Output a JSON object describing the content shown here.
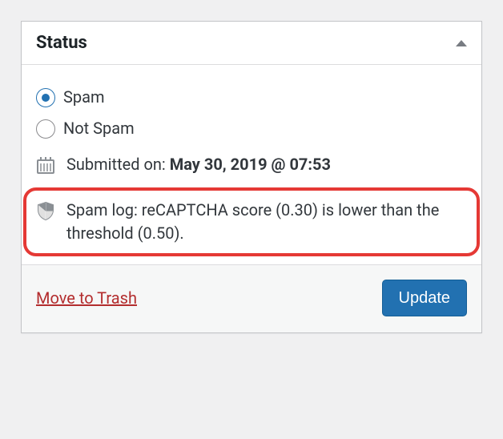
{
  "panel": {
    "title": "Status"
  },
  "status_options": {
    "spam": "Spam",
    "not_spam": "Not Spam",
    "selected": "spam"
  },
  "submitted": {
    "label": "Submitted on: ",
    "value": "May 30, 2019 @ 07:53"
  },
  "spam_log": {
    "text": "Spam log: reCAPTCHA score (0.30) is lower than the threshold (0.50)."
  },
  "footer": {
    "trash": "Move to Trash",
    "update": "Update"
  }
}
